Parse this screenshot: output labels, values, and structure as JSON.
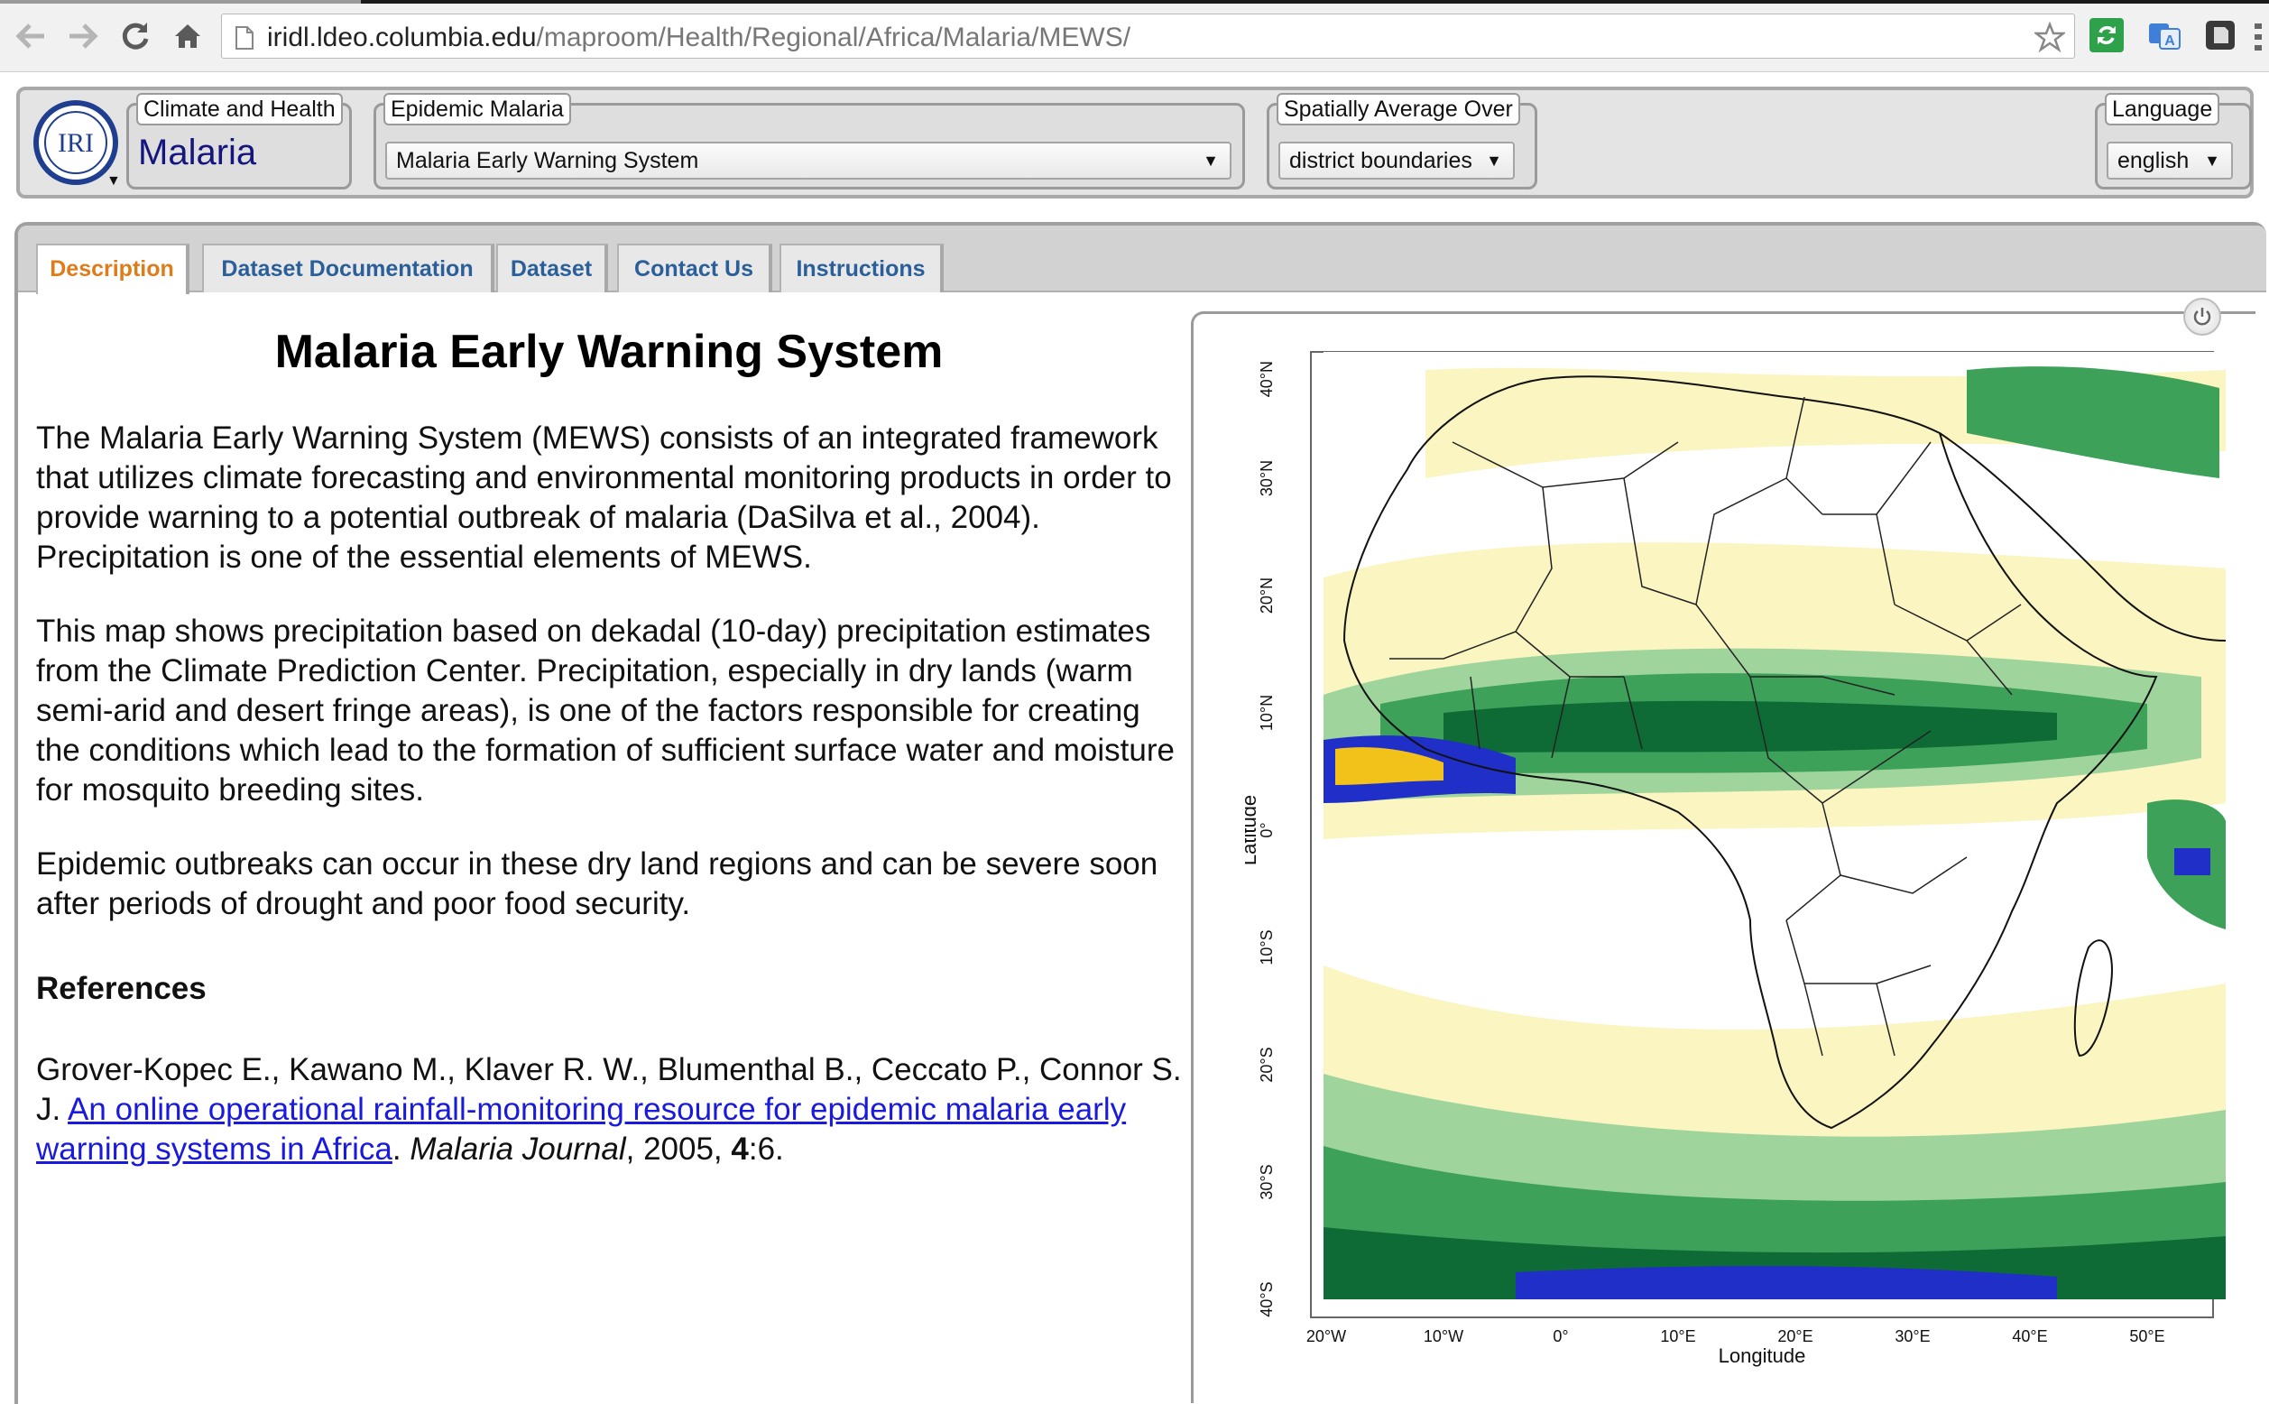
{
  "browser": {
    "url_host": "iridl.ldeo.columbia.edu",
    "url_path": "/maproom/Health/Regional/Africa/Malaria/MEWS/",
    "icons": [
      "back-arrow-icon",
      "forward-arrow-icon",
      "reload-icon",
      "home-icon",
      "page-icon",
      "star-icon"
    ],
    "extensions": [
      "sync-extension-icon",
      "translate-extension-icon",
      "evernote-extension-icon"
    ]
  },
  "header": {
    "group1_legend": "Climate and Health",
    "group1_title": "Malaria",
    "group2_legend": "Epidemic Malaria",
    "group2_selected": "Malaria Early Warning System",
    "group3_legend": "Spatially Average Over",
    "group3_selected": "district boundaries",
    "language_legend": "Language",
    "language_selected": "english",
    "logo_text": "IRI"
  },
  "tabs": [
    {
      "label": "Description",
      "active": true
    },
    {
      "label": "Dataset Documentation",
      "active": false
    },
    {
      "label": "Dataset",
      "active": false
    },
    {
      "label": "Contact Us",
      "active": false
    },
    {
      "label": "Instructions",
      "active": false
    }
  ],
  "description": {
    "title": "Malaria Early Warning System",
    "para1": "The Malaria Early Warning System (MEWS) consists of an integrated framework that utilizes climate forecasting and environmental monitoring products in order to provide warning to a potential outbreak of malaria (DaSilva et al., 2004). Precipitation is one of the essential elements of MEWS.",
    "para2": "This map shows precipitation based on dekadal (10-day) precipitation estimates from the Climate Prediction Center. Precipitation, especially in dry lands (warm semi-arid and desert fringe areas), is one of the factors responsible for creating the conditions which lead to the formation of sufficient surface water and moisture for mosquito breeding sites.",
    "para3": "Epidemic outbreaks can occur in these dry land regions and can be severe soon after periods of drought and poor food security.",
    "references_heading": "References",
    "ref_authors": "Grover-Kopec E., Kawano M., Klaver R. W., Blumenthal B., Ceccato P., Connor S. J.",
    "ref_link": "An online operational rainfall-monitoring resource for epidemic malaria early warning systems in Africa",
    "ref_journal": "Malaria Journal",
    "ref_year": "2005,",
    "ref_volume": "4",
    "ref_pages": ":6."
  },
  "map": {
    "ylabel": "Latitude",
    "xlabel": "Longitude",
    "y_ticks": [
      "40°N",
      "30°N",
      "20°N",
      "10°N",
      "0°",
      "10°S",
      "20°S",
      "30°S",
      "40°S"
    ],
    "x_ticks": [
      "20°W",
      "10°W",
      "0°",
      "10°E",
      "20°E",
      "30°E",
      "40°E",
      "50°E"
    ],
    "colors": {
      "light_yellow": "#fbf5c2",
      "light_green": "#9fd59d",
      "green": "#3da15a",
      "dark_green": "#0f6b35",
      "light_blue": "#8ec8ea",
      "blue": "#1f2fc8",
      "dark_blue": "#0a0a6e"
    }
  },
  "theme": {
    "tab_active": "#e07b1a",
    "tab_inactive": "#2a5f9a",
    "link": "#1a1adc",
    "brand_title": "#151580"
  }
}
